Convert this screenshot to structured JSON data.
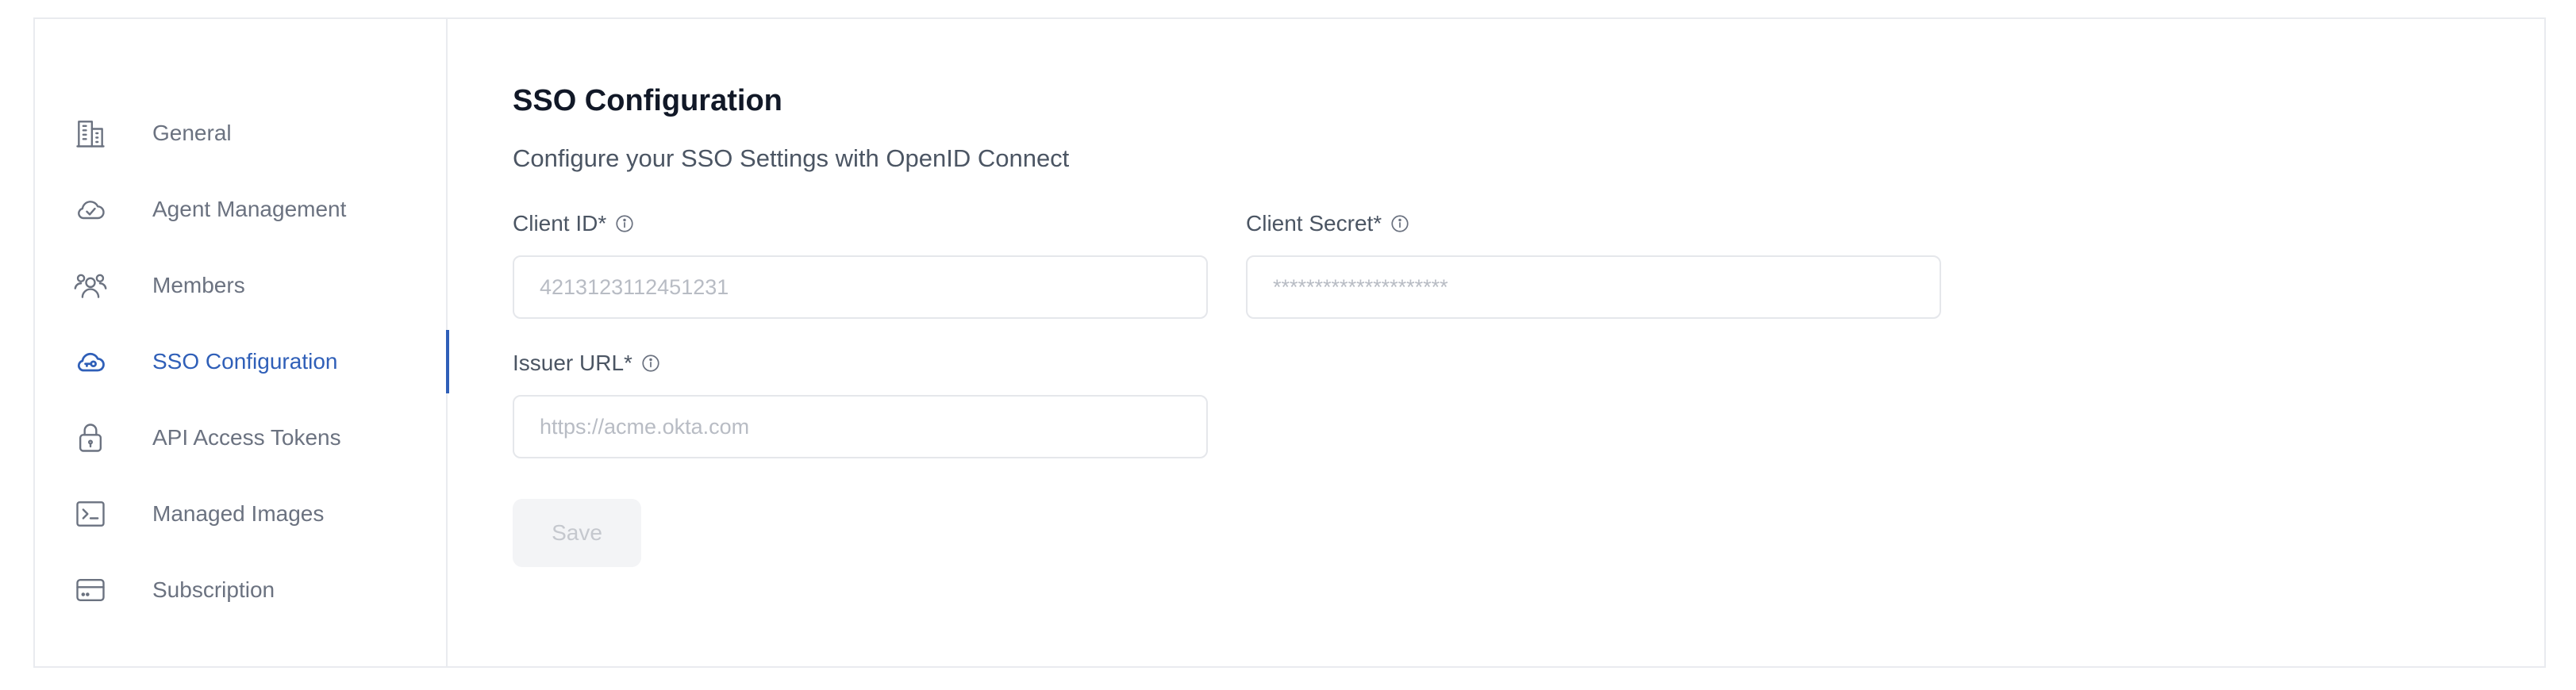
{
  "sidebar": {
    "items": [
      {
        "label": "General",
        "icon": "building-icon"
      },
      {
        "label": "Agent Management",
        "icon": "cloud-check-icon"
      },
      {
        "label": "Members",
        "icon": "users-icon"
      },
      {
        "label": "SSO Configuration",
        "icon": "cloud-key-icon",
        "active": true
      },
      {
        "label": "API Access Tokens",
        "icon": "lock-icon"
      },
      {
        "label": "Managed Images",
        "icon": "terminal-icon"
      },
      {
        "label": "Subscription",
        "icon": "credit-card-icon"
      }
    ]
  },
  "main": {
    "title": "SSO Configuration",
    "subtitle": "Configure your SSO Settings with OpenID Connect",
    "client_id": {
      "label": "Client ID*",
      "placeholder": "4213123112451231",
      "value": ""
    },
    "client_secret": {
      "label": "Client Secret*",
      "placeholder": "*********************",
      "value": ""
    },
    "issuer_url": {
      "label": "Issuer URL*",
      "placeholder": "https://acme.okta.com",
      "value": ""
    },
    "save_label": "Save"
  },
  "colors": {
    "accent": "#2f5fb8",
    "muted_text": "#6b7280",
    "border": "#e9ebef",
    "button_disabled_bg": "#f3f4f6"
  }
}
